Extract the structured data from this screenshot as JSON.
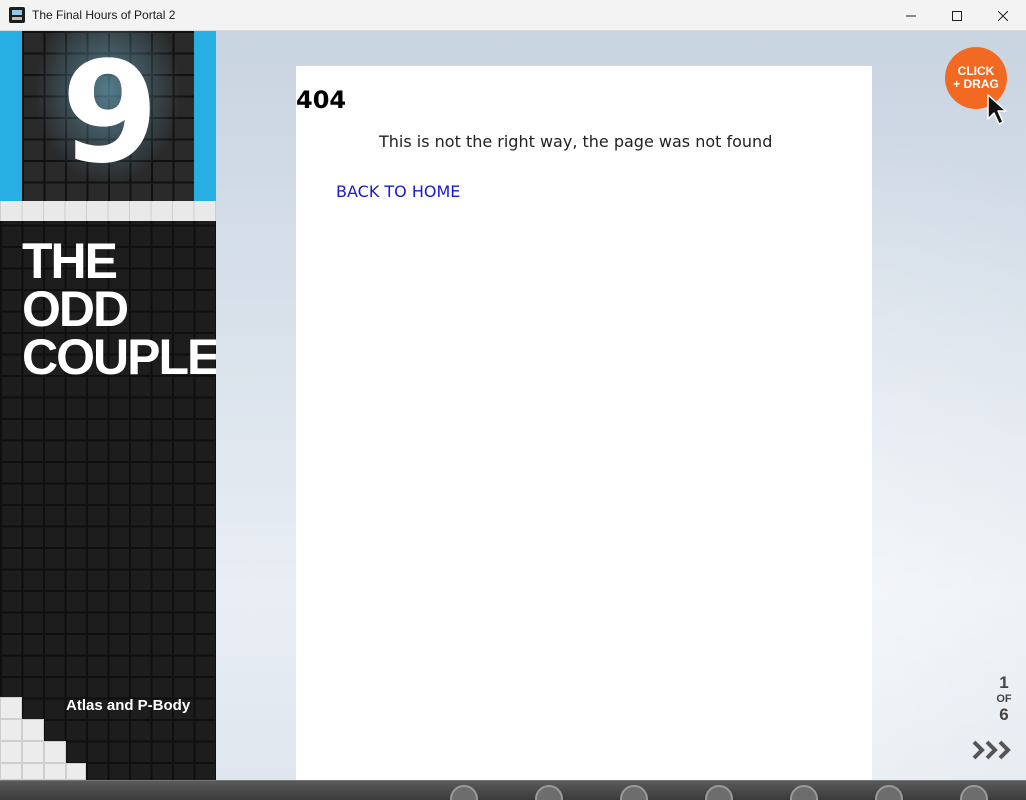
{
  "window": {
    "title": "The Final Hours of Portal 2"
  },
  "chapter": {
    "number": "9",
    "title_lines": [
      "THE",
      "ODD",
      "COUPLE"
    ],
    "subtitle": "Atlas and P-Body",
    "accent_color": "#27aee3"
  },
  "page": {
    "error_code": "404",
    "message": "This is not the right way, the page was not found",
    "back_link": "BACK TO HOME"
  },
  "drag_badge": {
    "line1": "CLICK",
    "line2": "+ DRAG",
    "color": "#f26a21"
  },
  "pager": {
    "current": "1",
    "of_label": "OF",
    "total": "6",
    "next_icon": "triple-chevron-right-icon"
  },
  "icons": {
    "minimize": "minimize-icon",
    "maximize": "maximize-icon",
    "close": "close-icon",
    "cursor": "mouse-pointer-icon"
  }
}
